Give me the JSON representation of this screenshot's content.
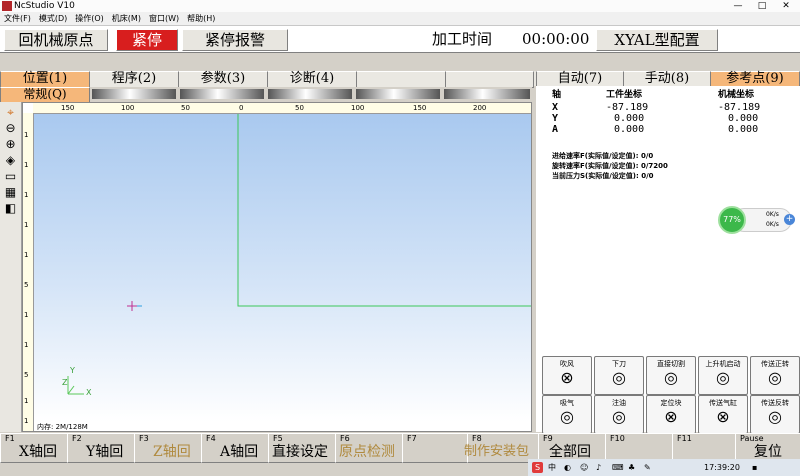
{
  "window": {
    "title": "NcStudio V10",
    "controls": [
      "—",
      "□",
      "✕"
    ]
  },
  "menu": [
    "文件(F)",
    "模式(D)",
    "操作(O)",
    "机床(M)",
    "窗口(W)",
    "帮助(H)"
  ],
  "topbar": {
    "home_button": "回机械原点",
    "estop_button": "紧停",
    "estop_alarm": "紧停报警",
    "time_label": "加工时间",
    "time_value": "00:00:00",
    "config_button": "XYAL型配置"
  },
  "tabs_left": [
    "位置(1)",
    "程序(2)",
    "参数(3)",
    "诊断(4)",
    "",
    ""
  ],
  "tabs_right": [
    "自动(7)",
    "手动(8)",
    "参考点(9)"
  ],
  "subtab": "常规(Q)",
  "ruler": {
    "h_labels": [
      "150",
      "100",
      "50",
      "0",
      "50",
      "100",
      "150",
      "200"
    ],
    "v_labels": [
      "1",
      "1",
      "1",
      "1",
      "1",
      "5",
      "1",
      "1",
      "5",
      "1",
      "1"
    ]
  },
  "plot": {
    "axis_z": "Z",
    "axis_x": "X",
    "axis_y": "Y",
    "memory": "内存: 2M/128M"
  },
  "coords": {
    "axis_header": "轴",
    "work_header": "工件坐标",
    "machine_header": "机械坐标",
    "rows": [
      {
        "axis": "X",
        "work": "-87.189",
        "machine": "-87.189"
      },
      {
        "axis": "Y",
        "work": "0.000",
        "machine": "0.000"
      },
      {
        "axis": "A",
        "work": "0.000",
        "machine": "0.000"
      }
    ]
  },
  "feed": [
    "进给速率F(实际值/设定值): 0/0",
    "旋转速率F(实际值/设定值): 0/7200",
    "当前压力S(实际值/设定值): 0/0"
  ],
  "gauge": {
    "percent": "77%",
    "up": "0K/s",
    "down": "0K/s"
  },
  "io_buttons_row1": [
    "吹风",
    "下刀",
    "直接切割",
    "上升机启动",
    "传送正转"
  ],
  "io_buttons_row2": [
    "吸气",
    "注油",
    "定位块",
    "传送气缸",
    "传送反转"
  ],
  "fkeys": [
    {
      "num": "F1",
      "label": "X轴回",
      "dim": false
    },
    {
      "num": "F2",
      "label": "Y轴回",
      "dim": false
    },
    {
      "num": "F3",
      "label": "Z轴回",
      "dim": true
    },
    {
      "num": "F4",
      "label": "A轴回",
      "dim": false
    },
    {
      "num": "F5",
      "label": "直接设定",
      "dim": false
    },
    {
      "num": "F6",
      "label": "原点检测",
      "dim": true
    },
    {
      "num": "F7",
      "label": "",
      "dim": false
    },
    {
      "num": "F8",
      "label": "制作安装包",
      "dim": true
    },
    {
      "num": "F9",
      "label": "全部回",
      "dim": false
    },
    {
      "num": "F10",
      "label": "",
      "dim": false
    },
    {
      "num": "F11",
      "label": "",
      "dim": false
    },
    {
      "num": "Pause",
      "label": "复位",
      "dim": false
    }
  ],
  "taskbar": {
    "ime": "中",
    "clock": "17:39:20"
  },
  "colors": {
    "estop": "#d81e1e",
    "active_tab": "#f5b77a",
    "plot_top": "#a9c9ef",
    "workpiece_line": "#3cc85a"
  }
}
